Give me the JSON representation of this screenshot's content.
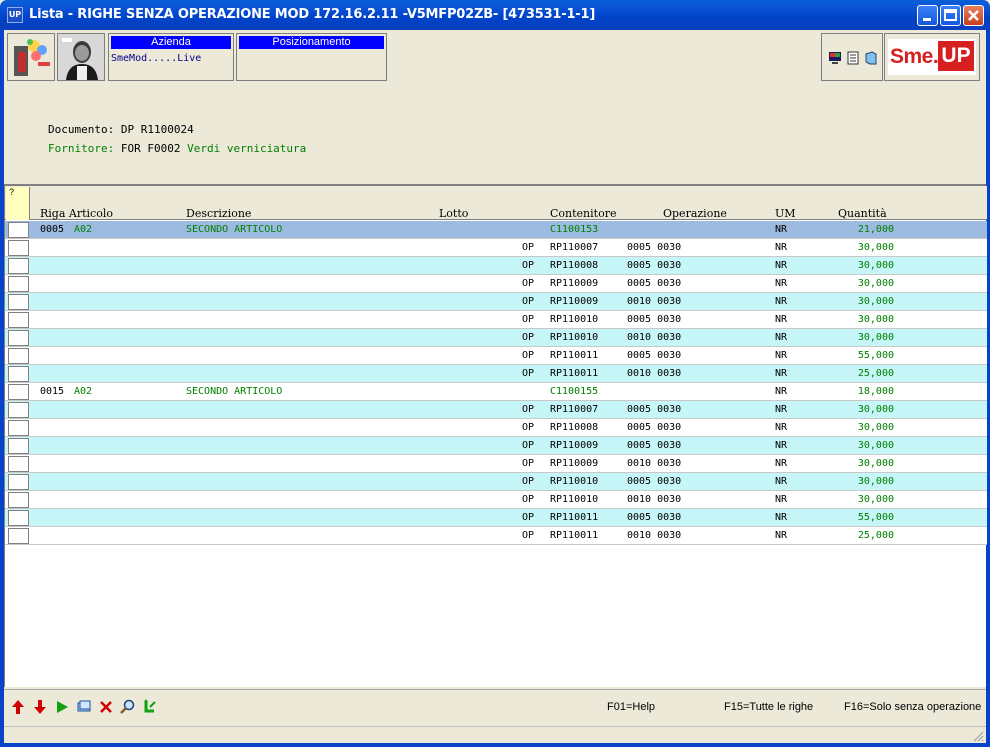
{
  "window": {
    "app_icon": "UP",
    "title": "Lista -  RIGHE SENZA OPERAZIONE MOD 172.16.2.11 -V5MFP02ZB- [473531-1-1]",
    "buttons": [
      "minimize",
      "maximize",
      "close"
    ]
  },
  "toolbar": {
    "azienda_label": "Azienda",
    "azienda_value": "SmeMod.....Live",
    "posizionamento_label": "Posizionamento",
    "logo_text_1": "Sme.",
    "logo_text_2": "UP"
  },
  "header": {
    "documento": "Documento: DP R1100024",
    "fornitore_label": "Fornitore:",
    "fornitore_code": "FOR F0002",
    "fornitore_name": "Verdi verniciatura"
  },
  "grid": {
    "question": "?",
    "columns": [
      "Riga Articolo",
      "Descrizione",
      "Lotto",
      "Contenitore",
      "Operazione",
      "UM",
      "Quantità"
    ],
    "rows": [
      {
        "riga": "0005",
        "articolo": "A02",
        "descrizione": "SECONDO ARTICOLO",
        "op": "",
        "contenitore": "C1100153",
        "operazione": "",
        "um": "NR",
        "quantita": "21,000",
        "type": "header",
        "style": "hl"
      },
      {
        "riga": "",
        "articolo": "",
        "descrizione": "",
        "op": "OP",
        "contenitore": "RP110007",
        "operazione": "0005 0030",
        "um": "NR",
        "quantita": "30,000",
        "type": "detail",
        "style": "plain"
      },
      {
        "riga": "",
        "articolo": "",
        "descrizione": "",
        "op": "OP",
        "contenitore": "RP110008",
        "operazione": "0005 0030",
        "um": "NR",
        "quantita": "30,000",
        "type": "detail",
        "style": "alt"
      },
      {
        "riga": "",
        "articolo": "",
        "descrizione": "",
        "op": "OP",
        "contenitore": "RP110009",
        "operazione": "0005 0030",
        "um": "NR",
        "quantita": "30,000",
        "type": "detail",
        "style": "plain"
      },
      {
        "riga": "",
        "articolo": "",
        "descrizione": "",
        "op": "OP",
        "contenitore": "RP110009",
        "operazione": "0010 0030",
        "um": "NR",
        "quantita": "30,000",
        "type": "detail",
        "style": "alt"
      },
      {
        "riga": "",
        "articolo": "",
        "descrizione": "",
        "op": "OP",
        "contenitore": "RP110010",
        "operazione": "0005 0030",
        "um": "NR",
        "quantita": "30,000",
        "type": "detail",
        "style": "plain"
      },
      {
        "riga": "",
        "articolo": "",
        "descrizione": "",
        "op": "OP",
        "contenitore": "RP110010",
        "operazione": "0010 0030",
        "um": "NR",
        "quantita": "30,000",
        "type": "detail",
        "style": "alt"
      },
      {
        "riga": "",
        "articolo": "",
        "descrizione": "",
        "op": "OP",
        "contenitore": "RP110011",
        "operazione": "0005 0030",
        "um": "NR",
        "quantita": "55,000",
        "type": "detail",
        "style": "plain"
      },
      {
        "riga": "",
        "articolo": "",
        "descrizione": "",
        "op": "OP",
        "contenitore": "RP110011",
        "operazione": "0010 0030",
        "um": "NR",
        "quantita": "25,000",
        "type": "detail",
        "style": "alt"
      },
      {
        "riga": "0015",
        "articolo": "A02",
        "descrizione": "SECONDO ARTICOLO",
        "op": "",
        "contenitore": "C1100155",
        "operazione": "",
        "um": "NR",
        "quantita": "18,000",
        "type": "header",
        "style": "plain"
      },
      {
        "riga": "",
        "articolo": "",
        "descrizione": "",
        "op": "OP",
        "contenitore": "RP110007",
        "operazione": "0005 0030",
        "um": "NR",
        "quantita": "30,000",
        "type": "detail",
        "style": "alt"
      },
      {
        "riga": "",
        "articolo": "",
        "descrizione": "",
        "op": "OP",
        "contenitore": "RP110008",
        "operazione": "0005 0030",
        "um": "NR",
        "quantita": "30,000",
        "type": "detail",
        "style": "plain"
      },
      {
        "riga": "",
        "articolo": "",
        "descrizione": "",
        "op": "OP",
        "contenitore": "RP110009",
        "operazione": "0005 0030",
        "um": "NR",
        "quantita": "30,000",
        "type": "detail",
        "style": "alt"
      },
      {
        "riga": "",
        "articolo": "",
        "descrizione": "",
        "op": "OP",
        "contenitore": "RP110009",
        "operazione": "0010 0030",
        "um": "NR",
        "quantita": "30,000",
        "type": "detail",
        "style": "plain"
      },
      {
        "riga": "",
        "articolo": "",
        "descrizione": "",
        "op": "OP",
        "contenitore": "RP110010",
        "operazione": "0005 0030",
        "um": "NR",
        "quantita": "30,000",
        "type": "detail",
        "style": "alt"
      },
      {
        "riga": "",
        "articolo": "",
        "descrizione": "",
        "op": "OP",
        "contenitore": "RP110010",
        "operazione": "0010 0030",
        "um": "NR",
        "quantita": "30,000",
        "type": "detail",
        "style": "plain"
      },
      {
        "riga": "",
        "articolo": "",
        "descrizione": "",
        "op": "OP",
        "contenitore": "RP110011",
        "operazione": "0005 0030",
        "um": "NR",
        "quantita": "55,000",
        "type": "detail",
        "style": "alt"
      },
      {
        "riga": "",
        "articolo": "",
        "descrizione": "",
        "op": "OP",
        "contenitore": "RP110011",
        "operazione": "0010 0030",
        "um": "NR",
        "quantita": "25,000",
        "type": "detail",
        "style": "plain"
      }
    ]
  },
  "bottom": {
    "icons": [
      "arrow-up-icon",
      "arrow-down-icon",
      "play-icon",
      "window-icon",
      "delete-icon",
      "search-icon",
      "refresh-icon"
    ],
    "f01": "F01=Help",
    "f15": "F15=Tutte le righe",
    "f16": "F16=Solo senza operazione"
  },
  "colors": {
    "title_bar": "#0b56d8",
    "selected_row": "#9dbae0",
    "alt_row": "#c6f6f8",
    "green_text": "#008000",
    "panel_header": "#0000ff"
  }
}
